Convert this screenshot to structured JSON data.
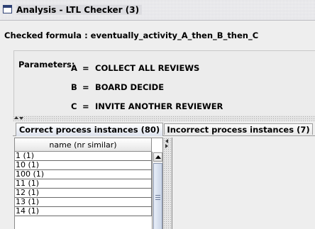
{
  "window": {
    "title": "Analysis - LTL Checker (3)"
  },
  "formula": {
    "text": "Checked formula : eventually_activity_A_then_B_then_C"
  },
  "parameters": {
    "label": "Parameters:",
    "items": [
      {
        "key": "A",
        "eq": "=",
        "value": "COLLECT ALL REVIEWS"
      },
      {
        "key": "B",
        "eq": "=",
        "value": "BOARD DECIDE"
      },
      {
        "key": "C",
        "eq": "=",
        "value": "INVITE ANOTHER REVIEWER"
      }
    ]
  },
  "tabs": [
    {
      "label": "Correct process instances (80)",
      "selected": true
    },
    {
      "label": "Incorrect process instances (7)",
      "selected": false
    }
  ],
  "list": {
    "column_header": "name (nr similar)",
    "rows": [
      "1 (1)",
      "10 (1)",
      "100 (1)",
      "11 (1)",
      "12 (1)",
      "13 (1)",
      "14 (1)"
    ]
  },
  "colors": {
    "background": "#eeeeee",
    "selected_tab": "#dde3ee",
    "scroll_thumb": "#c9d4e6"
  }
}
